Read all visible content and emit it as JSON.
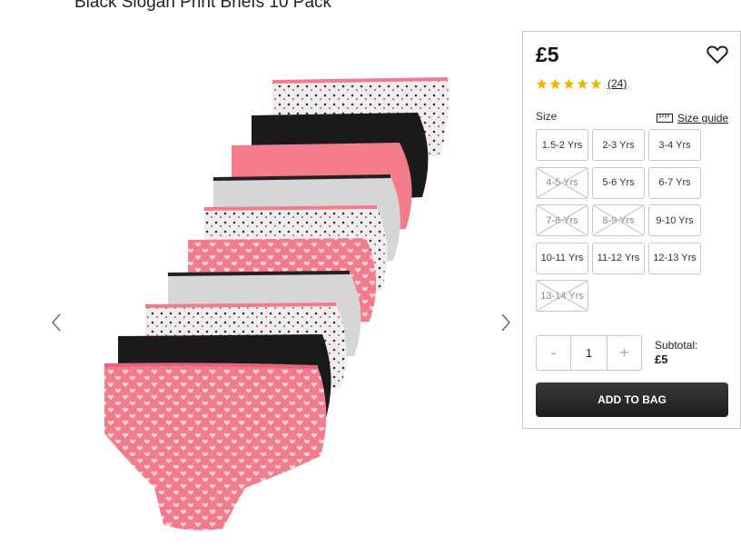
{
  "product": {
    "title": "Black Slogan Print Briefs 10 Pack",
    "image_alt": "10 pack of girls briefs in pink, black, grey and heart prints"
  },
  "gallery": {
    "prev_icon": "chevron-left-icon",
    "next_icon": "chevron-right-icon"
  },
  "panel": {
    "price": "£5",
    "wishlist_icon": "heart-icon",
    "rating": {
      "stars": 5,
      "review_count": "(24)",
      "star_color": "#f2b600"
    },
    "size_label": "Size",
    "size_guide_label": "Size guide",
    "sizes": [
      {
        "label": "1.5-2 Yrs",
        "available": true
      },
      {
        "label": "2-3 Yrs",
        "available": true
      },
      {
        "label": "3-4 Yrs",
        "available": true
      },
      {
        "label": "4-5 Yrs",
        "available": false
      },
      {
        "label": "5-6 Yrs",
        "available": true
      },
      {
        "label": "6-7 Yrs",
        "available": true
      },
      {
        "label": "7-8 Yrs",
        "available": false
      },
      {
        "label": "8-9 Yrs",
        "available": false
      },
      {
        "label": "9-10 Yrs",
        "available": true
      },
      {
        "label": "10-11 Yrs",
        "available": true
      },
      {
        "label": "11-12 Yrs",
        "available": true
      },
      {
        "label": "12-13 Yrs",
        "available": true
      },
      {
        "label": "13-14 Yrs",
        "available": false
      }
    ],
    "quantity": {
      "minus": "-",
      "value": "1",
      "plus": "+"
    },
    "subtotal_label": "Subtotal:",
    "subtotal_value": "£5",
    "add_to_bag": "ADD TO BAG"
  },
  "colors": {
    "pink": "#f47b8c",
    "black": "#1a1a1a",
    "grey": "#d6d6d6",
    "button": "#262626"
  }
}
